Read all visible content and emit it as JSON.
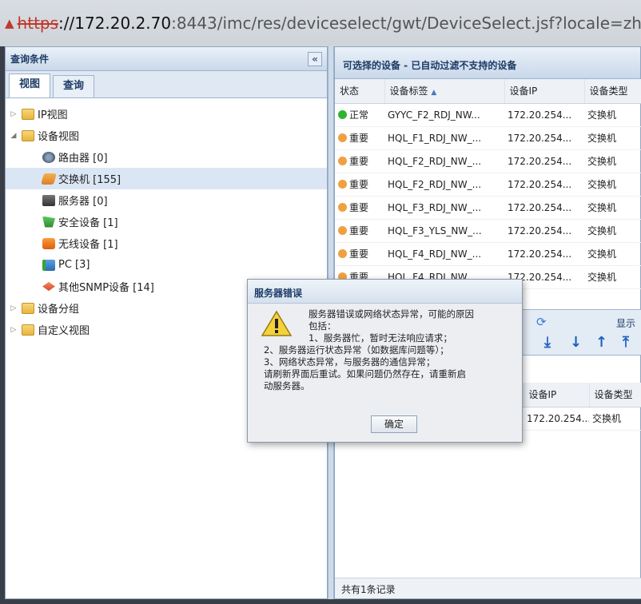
{
  "browser": {
    "url_scheme": "https",
    "url_host": "://172.20.2.70",
    "url_port": ":8443",
    "url_path": "/imc/res/deviceselect/gwt/DeviceSelect.jsf?locale=zh_CN&beanNa"
  },
  "left_panel": {
    "title": "查询条件",
    "collapse_glyph": "«",
    "tabs": [
      "视图",
      "查询"
    ],
    "tree": [
      {
        "label": "IP视图",
        "level": 0,
        "expander": "▷",
        "icon": "folder-icon"
      },
      {
        "label": "设备视图",
        "level": 0,
        "expander": "◢",
        "icon": "folder-icon"
      },
      {
        "label": "路由器 [0]",
        "level": 1,
        "expander": "",
        "icon": "router-icon"
      },
      {
        "label": "交换机 [155]",
        "level": 1,
        "expander": "",
        "icon": "switch-icon",
        "selected": true
      },
      {
        "label": "服务器 [0]",
        "level": 1,
        "expander": "",
        "icon": "server-icon"
      },
      {
        "label": "安全设备 [1]",
        "level": 1,
        "expander": "",
        "icon": "security-icon"
      },
      {
        "label": "无线设备 [1]",
        "level": 1,
        "expander": "",
        "icon": "wireless-icon"
      },
      {
        "label": "PC [3]",
        "level": 1,
        "expander": "",
        "icon": "pc-icon"
      },
      {
        "label": "其他SNMP设备 [14]",
        "level": 1,
        "expander": "",
        "icon": "snmp-icon"
      },
      {
        "label": "设备分组",
        "level": 0,
        "expander": "▷",
        "icon": "folder-icon"
      },
      {
        "label": "自定义视图",
        "level": 0,
        "expander": "▷",
        "icon": "folder-icon"
      }
    ]
  },
  "right_panel": {
    "title": "可选择的设备 - 已自动过滤不支持的设备",
    "columns": [
      "状态",
      "设备标签",
      "设备IP",
      "设备类型"
    ],
    "rows": [
      {
        "status": "正常",
        "status_color": "#2db52d",
        "label": "GYYC_F2_RDJ_NW...",
        "ip": "172.20.254...",
        "type": "交换机"
      },
      {
        "status": "重要",
        "status_color": "#f0a040",
        "label": "HQL_F1_RDJ_NW_...",
        "ip": "172.20.254...",
        "type": "交换机"
      },
      {
        "status": "重要",
        "status_color": "#f0a040",
        "label": "HQL_F2_RDJ_NW_...",
        "ip": "172.20.254...",
        "type": "交换机"
      },
      {
        "status": "重要",
        "status_color": "#f0a040",
        "label": "HQL_F2_RDJ_NW_...",
        "ip": "172.20.254...",
        "type": "交换机"
      },
      {
        "status": "重要",
        "status_color": "#f0a040",
        "label": "HQL_F3_RDJ_NW_...",
        "ip": "172.20.254...",
        "type": "交换机"
      },
      {
        "status": "重要",
        "status_color": "#f0a040",
        "label": "HQL_F3_YLS_NW_...",
        "ip": "172.20.254...",
        "type": "交换机"
      },
      {
        "status": "重要",
        "status_color": "#f0a040",
        "label": "HQL_F4_RDJ_NW_...",
        "ip": "172.20.254...",
        "type": "交换机"
      },
      {
        "status": "重要",
        "status_color": "#f0a040",
        "label": "HQL_F4_RDJ_NW...",
        "ip": "172.20.254...",
        "type": "交换机"
      }
    ],
    "toolbar_show_label": "显示",
    "selected_columns": [
      "设备IP",
      "设备类型"
    ],
    "selected_row": {
      "ip": "172.20.254...",
      "type": "交换机"
    },
    "footer": "共有1条记录"
  },
  "dialog": {
    "title": "服务器错误",
    "lines": [
      "服务器错误或网络状态异常，可能的原因",
      "包括：",
      "1、服务器忙，暂时无法响应请求；",
      "2、服务器运行状态异常（如数据库问题等）；",
      "3、网络状态异常，与服务器的通信异常；",
      "请刷新界面后重试。如果问题仍然存在，请重新启",
      "动服务器。"
    ],
    "ok_label": "确定"
  }
}
